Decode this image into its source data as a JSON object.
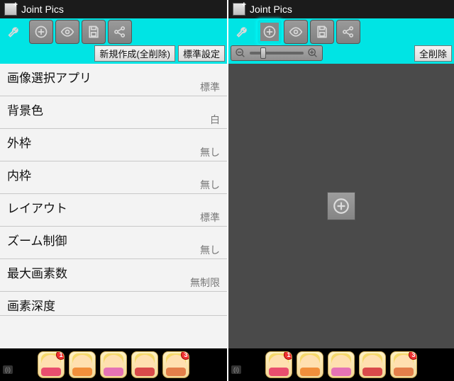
{
  "app_title": "Joint Pics",
  "left": {
    "buttons": {
      "new": "新規作成(全削除)",
      "defaults": "標準設定"
    },
    "settings": [
      {
        "label": "画像選択アプリ",
        "value": "標準"
      },
      {
        "label": "背景色",
        "value": "白"
      },
      {
        "label": "外枠",
        "value": "無し"
      },
      {
        "label": "内枠",
        "value": "無し"
      },
      {
        "label": "レイアウト",
        "value": "標準"
      },
      {
        "label": "ズーム制御",
        "value": "無し"
      },
      {
        "label": "最大画素数",
        "value": "無制限"
      },
      {
        "label": "画素深度",
        "value": ""
      }
    ]
  },
  "right": {
    "buttons": {
      "clear_all": "全削除"
    }
  },
  "shortcuts": {
    "badges": [
      "1",
      "",
      "",
      "",
      "3"
    ]
  },
  "icons": {
    "wrench": "wrench-icon",
    "add": "add-icon",
    "eye": "eye-icon",
    "save": "save-icon",
    "share": "share-icon",
    "zoom_out": "zoom-out-icon",
    "zoom_in": "zoom-in-icon"
  }
}
